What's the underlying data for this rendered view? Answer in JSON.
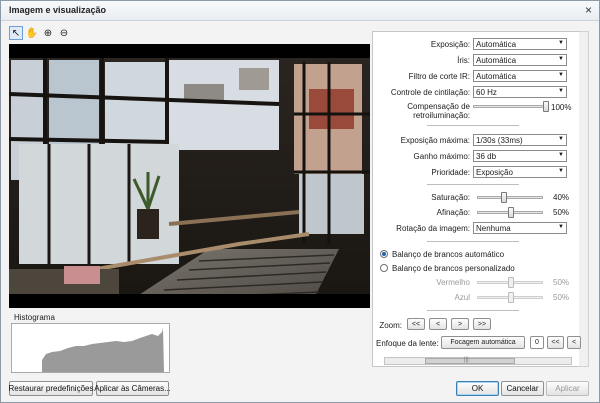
{
  "window": {
    "title": "Imagem e visualização",
    "close_glyph": "×"
  },
  "toolbar": {
    "tools": [
      {
        "name": "pointer-icon",
        "glyph": "↖"
      },
      {
        "name": "pan-hand-icon",
        "glyph": "✋"
      },
      {
        "name": "zoom-in-icon",
        "glyph": "⊕"
      },
      {
        "name": "zoom-out-icon",
        "glyph": "⊖"
      }
    ]
  },
  "histogram": {
    "label": "Histograma"
  },
  "settings": {
    "exposure": {
      "label": "Exposição:",
      "value": "Automática"
    },
    "iris": {
      "label": "Íris:",
      "value": "Automática"
    },
    "ir_cut": {
      "label": "Filtro de corte IR:",
      "value": "Automática"
    },
    "flicker": {
      "label": "Controle de cintilação:",
      "value": "60 Hz"
    },
    "backlight": {
      "label_line1": "Compensação de",
      "label_line2": "retroiluminação:",
      "value": "100%",
      "level": 1.0
    },
    "max_exposure": {
      "label": "Exposição máxima:",
      "value": "1/30s (33ms)"
    },
    "max_gain": {
      "label": "Ganho máximo:",
      "value": "36 db"
    },
    "priority": {
      "label": "Prioridade:",
      "value": "Exposição"
    },
    "saturation": {
      "label": "Saturação:",
      "value": "40%",
      "level": 0.4
    },
    "sharpening": {
      "label": "Afinação:",
      "value": "50%",
      "level": 0.5
    },
    "rotation": {
      "label": "Rotação da imagem:",
      "value": "Nenhuma"
    },
    "wb_auto": {
      "label": "Balanço de brancos automático",
      "checked": true
    },
    "wb_custom": {
      "label": "Balanço de brancos personalizado",
      "checked": false
    },
    "red": {
      "label": "Vermelho",
      "value": "50%",
      "level": 0.5
    },
    "blue": {
      "label": "Azul",
      "value": "50%",
      "level": 0.5
    },
    "zoom": {
      "label": "Zoom:",
      "buttons": [
        "<<",
        "<",
        ">",
        ">>"
      ]
    },
    "focus": {
      "label": "Enfoque da lente:",
      "auto_button": "Focagem automática",
      "value": "0",
      "buttons": [
        "<<",
        "<"
      ]
    },
    "hscroll_glyph": "|||"
  },
  "footer": {
    "restore": "Restaurar predefinições",
    "apply_cameras": "Aplicar às Câmeras...",
    "ok": "OK",
    "cancel": "Cancelar",
    "apply": "Aplicar"
  }
}
